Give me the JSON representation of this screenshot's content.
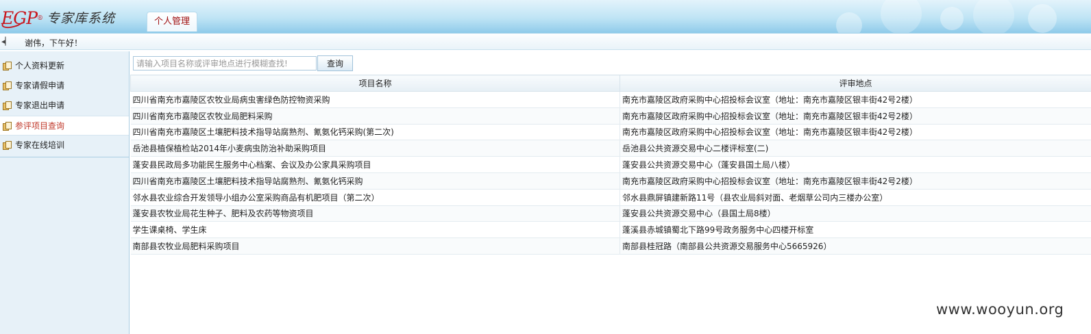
{
  "header": {
    "logo_mark": "EGP",
    "logo_reg": "®",
    "system_title": "专家库系统",
    "tab_label": "个人管理"
  },
  "greeting": {
    "text": "谢伟，下午好！"
  },
  "sidebar": {
    "items": [
      {
        "label": "个人资料更新",
        "active": false
      },
      {
        "label": "专家请假申请",
        "active": false
      },
      {
        "label": "专家退出申请",
        "active": false
      },
      {
        "label": "参评项目查询",
        "active": true
      },
      {
        "label": "专家在线培训",
        "active": false
      }
    ]
  },
  "search": {
    "placeholder": "请输入项目名称或评审地点进行模糊查找!",
    "value": "",
    "button_label": "查询"
  },
  "table": {
    "columns": [
      "项目名称",
      "评审地点"
    ],
    "rows": [
      [
        "四川省南充市嘉陵区农牧业局病虫害绿色防控物资采购",
        "南充市嘉陵区政府采购中心招投标会议室（地址：南充市嘉陵区银丰街42号2楼）"
      ],
      [
        "四川省南充市嘉陵区农牧业局肥料采购",
        "南充市嘉陵区政府采购中心招投标会议室（地址：南充市嘉陵区银丰街42号2楼）"
      ],
      [
        "四川省南充市嘉陵区土壤肥料技术指导站腐熟剂、氰氨化钙采购(第二次)",
        "南充市嘉陵区政府采购中心招投标会议室（地址：南充市嘉陵区银丰街42号2楼）"
      ],
      [
        "岳池县植保植检站2014年小麦病虫防治补助采购项目",
        "岳池县公共资源交易中心二楼评标室(二)"
      ],
      [
        "蓬安县民政局多功能民生服务中心档案、会议及办公家具采购项目",
        "蓬安县公共资源交易中心（蓬安县国土局八楼）"
      ],
      [
        "四川省南充市嘉陵区土壤肥料技术指导站腐熟剂、氰氨化钙采购",
        "南充市嘉陵区政府采购中心招投标会议室（地址：南充市嘉陵区银丰街42号2楼）"
      ],
      [
        "邻水县农业综合开发领导小组办公室采购商品有机肥项目（第二次）",
        "邻水县鼎屏镇建新路11号（县农业局斜对面、老烟草公司内三楼办公室）"
      ],
      [
        "蓬安县农牧业局花生种子、肥料及农药等物资项目",
        "蓬安县公共资源交易中心（县国土局8楼）"
      ],
      [
        "学生课桌椅、学生床",
        "蓬溪县赤城镇蜀北下路99号政务服务中心四楼开标室"
      ],
      [
        "南部县农牧业局肥料采购项目",
        "南部县桂冠路（南部县公共资源交易服务中心5665926）"
      ]
    ]
  },
  "watermark": "www.wooyun.org"
}
